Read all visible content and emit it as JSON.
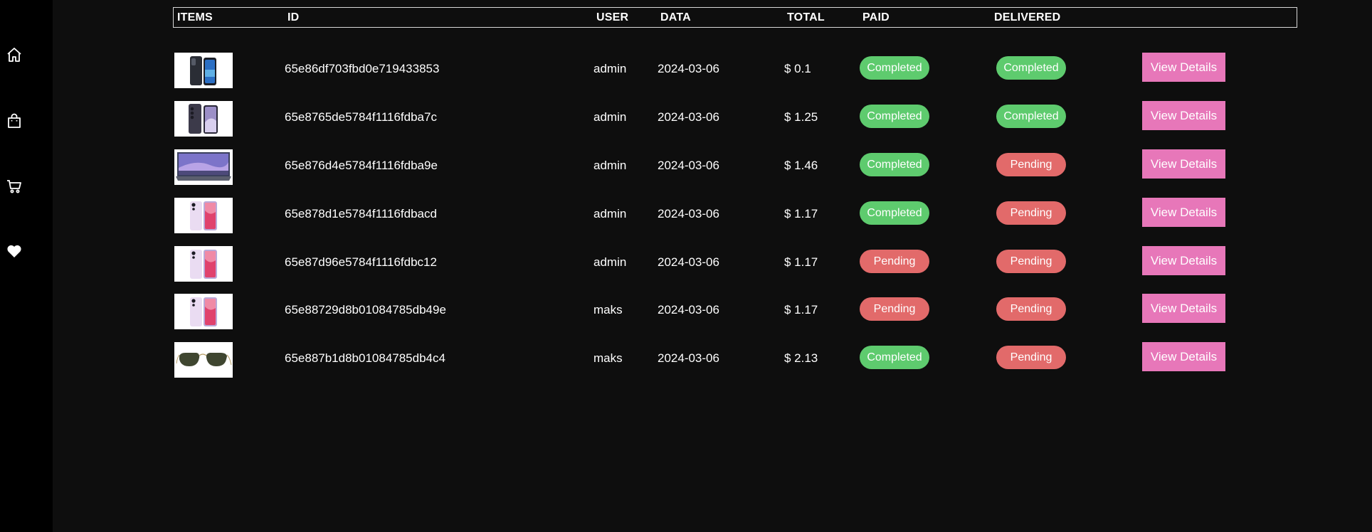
{
  "sidebar": {
    "items": [
      {
        "icon": "home-icon"
      },
      {
        "icon": "shopping-bag-icon"
      },
      {
        "icon": "cart-icon"
      },
      {
        "icon": "heart-icon"
      }
    ]
  },
  "table": {
    "headers": {
      "items": "ITEMS",
      "id": "ID",
      "user": "USER",
      "data": "DATA",
      "total": "TOTAL",
      "paid": "PAID",
      "delivered": "DELIVERED"
    },
    "action_label": "View Details",
    "rows": [
      {
        "thumb": "phone-dark",
        "id": "65e86df703fbd0e719433853",
        "user": "admin",
        "date": "2024-03-06",
        "total": "$ 0.1",
        "paid": "Completed",
        "delivered": "Completed"
      },
      {
        "thumb": "phone-purple",
        "id": "65e8765de5784f1116fdba7c",
        "user": "admin",
        "date": "2024-03-06",
        "total": "$ 1.25",
        "paid": "Completed",
        "delivered": "Completed"
      },
      {
        "thumb": "laptop",
        "id": "65e876d4e5784f1116fdba9e",
        "user": "admin",
        "date": "2024-03-06",
        "total": "$ 1.46",
        "paid": "Completed",
        "delivered": "Pending"
      },
      {
        "thumb": "phone-pink",
        "id": "65e878d1e5784f1116fdbacd",
        "user": "admin",
        "date": "2024-03-06",
        "total": "$ 1.17",
        "paid": "Completed",
        "delivered": "Pending"
      },
      {
        "thumb": "phone-pink",
        "id": "65e87d96e5784f1116fdbc12",
        "user": "admin",
        "date": "2024-03-06",
        "total": "$ 1.17",
        "paid": "Pending",
        "delivered": "Pending"
      },
      {
        "thumb": "phone-pink",
        "id": "65e88729d8b01084785db49e",
        "user": "maks",
        "date": "2024-03-06",
        "total": "$ 1.17",
        "paid": "Pending",
        "delivered": "Pending"
      },
      {
        "thumb": "sunglasses",
        "id": "65e887b1d8b01084785db4c4",
        "user": "maks",
        "date": "2024-03-06",
        "total": "$ 2.13",
        "paid": "Completed",
        "delivered": "Pending"
      }
    ]
  },
  "colors": {
    "completed": "#5ecb6e",
    "pending": "#e26a6a",
    "button": "#e777b9",
    "background": "#0e0e0e",
    "sidebar": "#000000"
  }
}
